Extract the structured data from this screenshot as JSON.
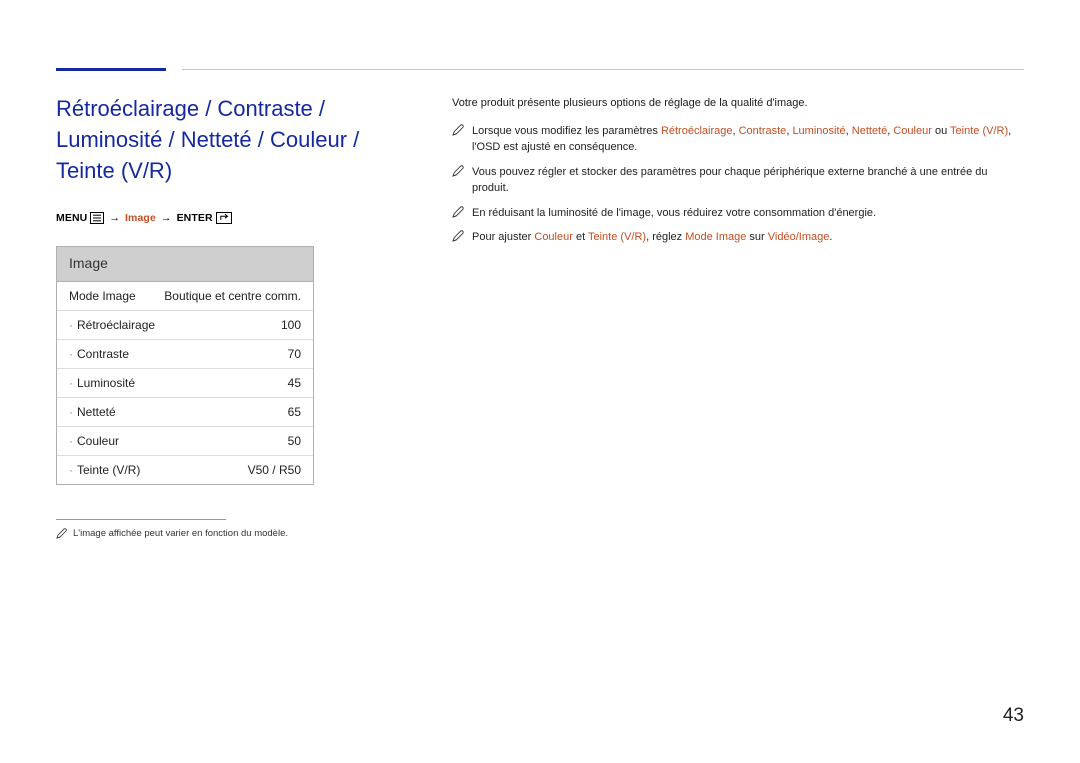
{
  "sectionTitle": "Rétroéclairage / Contraste / Luminosité / Netteté / Couleur / Teinte (V/R)",
  "breadcrumb": {
    "menu": "MENU",
    "image": "Image",
    "enter": "ENTER"
  },
  "panel": {
    "title": "Image",
    "modeField": {
      "label": "Mode Image",
      "value": "Boutique et centre comm."
    },
    "rows": [
      {
        "label": "Rétroéclairage",
        "value": "100"
      },
      {
        "label": "Contraste",
        "value": "70"
      },
      {
        "label": "Luminosité",
        "value": "45"
      },
      {
        "label": "Netteté",
        "value": "65"
      },
      {
        "label": "Couleur",
        "value": "50"
      },
      {
        "label": "Teinte (V/R)",
        "value": "V50 / R50"
      }
    ]
  },
  "footnote": "L'image affichée peut varier en fonction du modèle.",
  "intro": "Votre produit présente plusieurs options de réglage de la qualité d'image.",
  "notes": {
    "n1": {
      "pre": "Lorsque vous modifiez les paramètres ",
      "t1": "Rétroéclairage",
      "c1": ", ",
      "t2": "Contraste",
      "c2": ", ",
      "t3": "Luminosité",
      "c3": ", ",
      "t4": "Netteté",
      "c4": ", ",
      "t5": "Couleur",
      "c5": " ou ",
      "t6": "Teinte (V/R)",
      "post": ", l'OSD est ajusté en conséquence."
    },
    "n2": "Vous pouvez régler et stocker des paramètres pour chaque périphérique externe branché à une entrée du produit.",
    "n3": "En réduisant la luminosité de l'image, vous réduirez votre consommation d'énergie.",
    "n4": {
      "pre": "Pour ajuster ",
      "t1": "Couleur",
      "c1": " et ",
      "t2": "Teinte (V/R)",
      "mid": ", réglez ",
      "t3": "Mode Image",
      "c2": " sur ",
      "t4": "Vidéo/Image",
      "post": "."
    }
  },
  "pageNumber": "43"
}
